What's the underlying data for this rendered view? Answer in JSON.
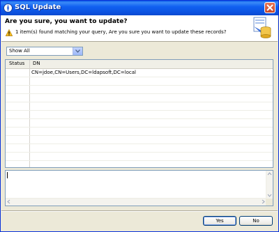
{
  "window": {
    "title": "SQL Update"
  },
  "header": {
    "title": "Are you sure, you want to update?",
    "message": "1 item(s) found matching your query, Are you sure you want to update these records?"
  },
  "filter": {
    "selected": "Show All"
  },
  "table": {
    "columns": [
      "Status",
      "DN"
    ],
    "rows": [
      {
        "status": "",
        "dn": "CN=jdoe,CN=Users,DC=ldapsoft,DC=local"
      }
    ]
  },
  "buttons": {
    "yes": "Yes",
    "no": "No"
  },
  "colors": {
    "titlebar": "#0c52e0",
    "dialog": "#ece9d8",
    "border": "#7f9db9"
  }
}
